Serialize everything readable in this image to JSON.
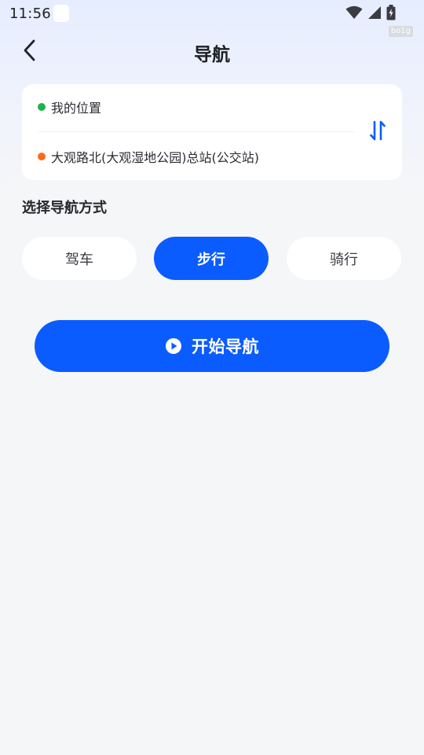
{
  "status_bar": {
    "time": "11:56"
  },
  "corner_tag": "bo1g",
  "header": {
    "title": "导航"
  },
  "route": {
    "start": "我的位置",
    "end": "大观路北(大观湿地公园)总站(公交站)"
  },
  "section": {
    "title": "选择导航方式"
  },
  "modes": {
    "drive": "驾车",
    "walk": "步行",
    "ride": "骑行"
  },
  "start_button": {
    "label": "开始导航"
  },
  "colors": {
    "accent": "#0a5cff",
    "start_dot": "#1db34a",
    "end_dot": "#ff6a1a",
    "background": "#f5f6f8",
    "card": "#ffffff"
  },
  "icons": {
    "back": "chevron-left-icon",
    "swap": "swap-vertical-icon",
    "play": "play-circle-icon",
    "wifi": "wifi-icon",
    "signal": "cellular-signal-icon",
    "battery": "battery-charging-icon"
  }
}
